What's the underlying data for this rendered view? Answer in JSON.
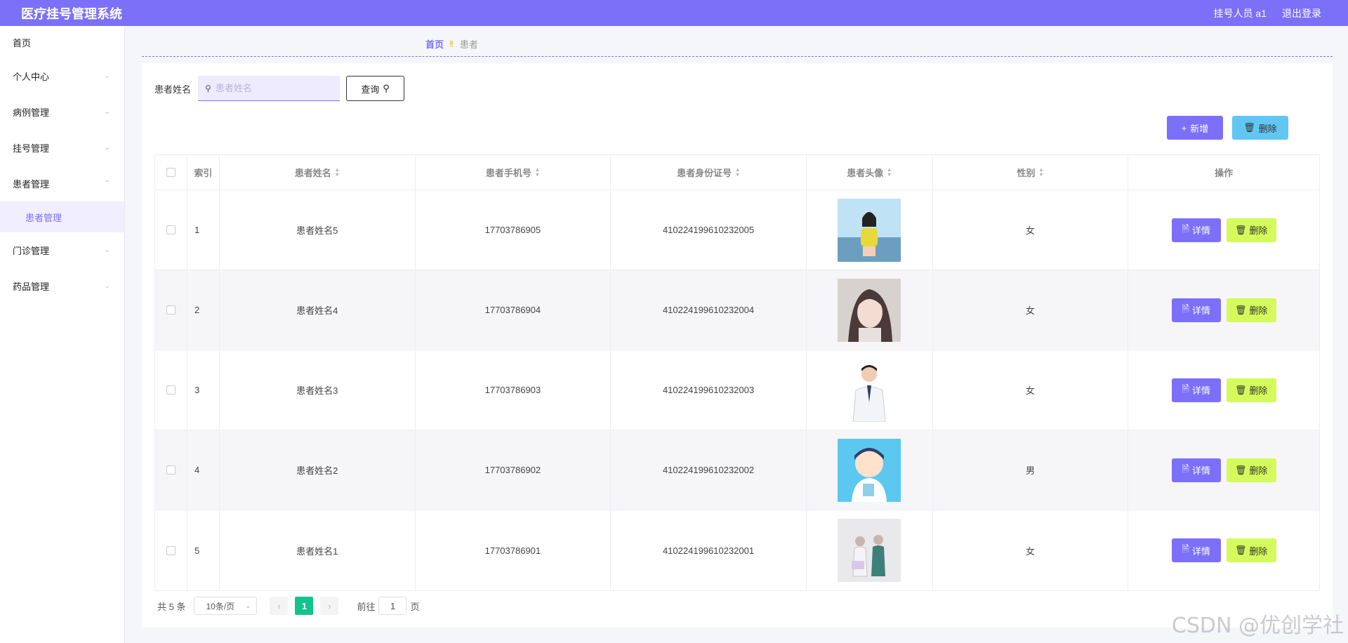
{
  "header": {
    "title": "医疗挂号管理系统",
    "user": "挂号人员 a1",
    "logout": "退出登录"
  },
  "sidebar": {
    "items": [
      {
        "label": "首页"
      },
      {
        "label": "个人中心"
      },
      {
        "label": "病例管理"
      },
      {
        "label": "挂号管理"
      },
      {
        "label": "患者管理"
      },
      {
        "label": "门诊管理"
      },
      {
        "label": "药品管理"
      }
    ],
    "active_sub": "患者管理"
  },
  "breadcrumb": {
    "home": "首页",
    "current": "患者"
  },
  "search": {
    "label": "患者姓名",
    "placeholder": "患者姓名",
    "button": "查询"
  },
  "toolbar": {
    "add": "新增",
    "delete": "删除"
  },
  "table": {
    "headers": [
      "索引",
      "患者姓名",
      "患者手机号",
      "患者身份证号",
      "患者头像",
      "性别",
      "操作"
    ],
    "rows": [
      {
        "index": "1",
        "name": "患者姓名5",
        "phone": "17703786905",
        "id_card": "410224199610232005",
        "gender": "女"
      },
      {
        "index": "2",
        "name": "患者姓名4",
        "phone": "17703786904",
        "id_card": "410224199610232004",
        "gender": "女"
      },
      {
        "index": "3",
        "name": "患者姓名3",
        "phone": "17703786903",
        "id_card": "410224199610232003",
        "gender": "女"
      },
      {
        "index": "4",
        "name": "患者姓名2",
        "phone": "17703786902",
        "id_card": "410224199610232002",
        "gender": "男"
      },
      {
        "index": "5",
        "name": "患者姓名1",
        "phone": "17703786901",
        "id_card": "410224199610232001",
        "gender": "女"
      }
    ],
    "detail_label": "详情",
    "delete_label": "删除"
  },
  "pagination": {
    "total": "共 5 条",
    "page_size": "10条/页",
    "current_page": "1",
    "goto_prefix": "前往",
    "goto_value": "1",
    "goto_suffix": "页"
  },
  "watermark": "CSDN @优创学社",
  "colors": {
    "primary": "#7b70f7",
    "delete_top": "#62c6f3",
    "delete_row": "#d4fb5b",
    "page_active": "#13c28d"
  }
}
